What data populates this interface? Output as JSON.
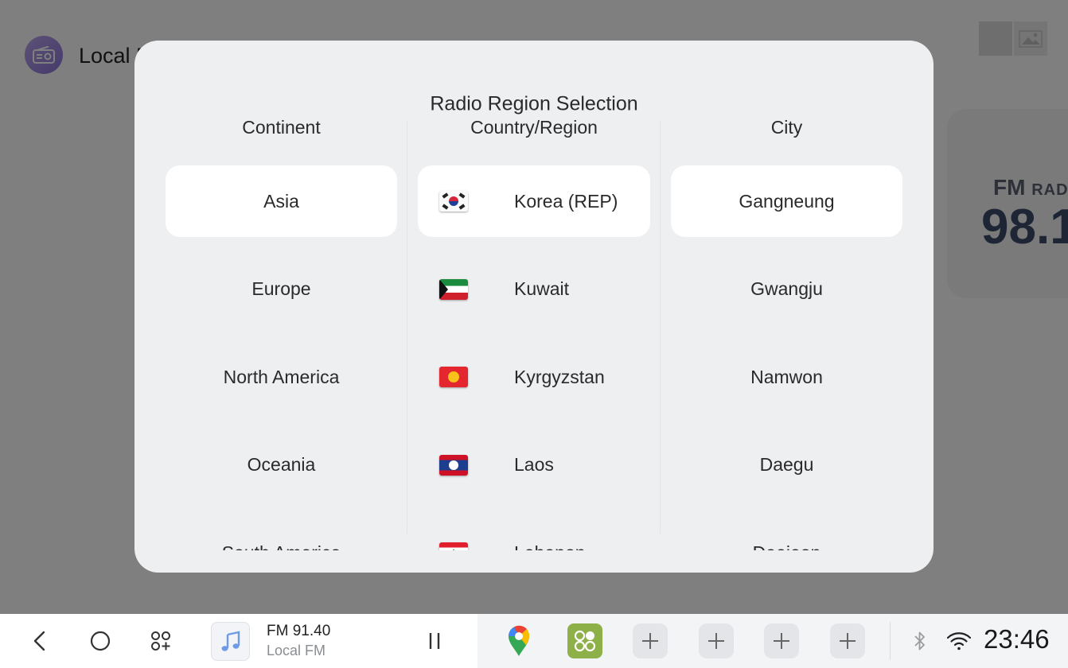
{
  "background_app": {
    "title": "Local F",
    "fm_card": {
      "band": "FM",
      "band_suffix": "RAD",
      "frequency": "98.1"
    }
  },
  "dialog": {
    "title": "Radio Region Selection",
    "columns": {
      "continent": {
        "header": "Continent",
        "items": [
          "Asia",
          "Europe",
          "North America",
          "Oceania",
          "South America"
        ],
        "selected": "Asia"
      },
      "country": {
        "header": "Country/Region",
        "items": [
          {
            "name": "Korea (REP)",
            "flag": "kr"
          },
          {
            "name": "Kuwait",
            "flag": "kw"
          },
          {
            "name": "Kyrgyzstan",
            "flag": "kg"
          },
          {
            "name": "Laos",
            "flag": "la"
          },
          {
            "name": "Lebanon",
            "flag": "lb"
          }
        ],
        "selected": "Korea (REP)"
      },
      "city": {
        "header": "City",
        "items": [
          "Gangneung",
          "Gwangju",
          "Namwon",
          "Daegu",
          "Daejeon"
        ],
        "selected": "Gangneung"
      }
    }
  },
  "taskbar": {
    "media": {
      "title": "FM 91.40",
      "subtitle": "Local FM"
    },
    "clock": "23:46",
    "icons": {
      "back": "back-arrow-icon",
      "home": "home-circle-icon",
      "apps": "app-grid-icon",
      "pause": "pause-icon",
      "maps": "google-maps-icon",
      "launcher": "app-launcher-icon",
      "add": "plus-icon",
      "bluetooth": "bluetooth-icon",
      "wifi": "wifi-icon"
    }
  },
  "colors": {
    "dialog_bg": "#eeeff1",
    "selected_bg": "#ffffff",
    "launcher_green": "#8eb048"
  }
}
